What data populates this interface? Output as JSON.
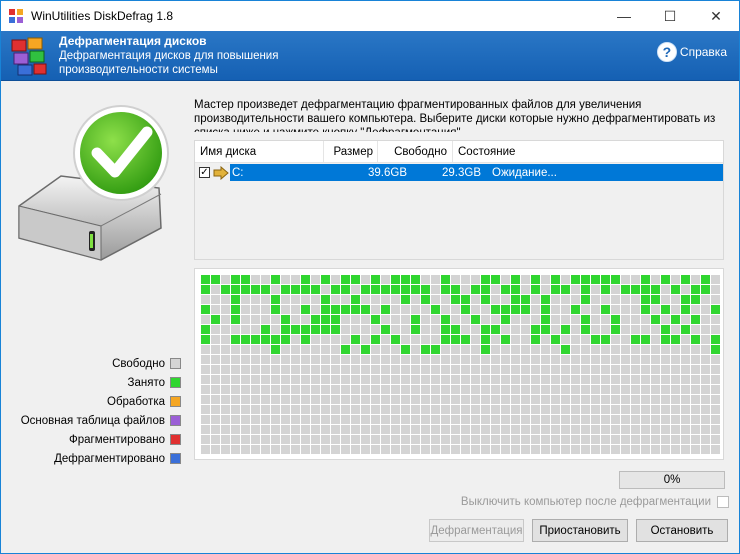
{
  "window": {
    "title": "WinUtilities DiskDefrag 1.8",
    "minimize": "—",
    "maximize": "☐",
    "close": "✕"
  },
  "banner": {
    "title": "Дефрагментация дисков",
    "description": "Дефрагментация дисков для повышения производительности системы",
    "help_label": "Справка",
    "help_icon": "?"
  },
  "intro_text": "Мастер произведет дефрагментацию фрагментированных файлов для увеличения производительности вашего компьютера. Выберите диски которые нужно дефрагментировать из списка ниже и нажмите кнопку \"Дефрагментация\"",
  "disk_list": {
    "columns": [
      "Имя диска",
      "Размер",
      "Свободно",
      "Состояние"
    ],
    "rows": [
      {
        "checked": "✓",
        "name": "C:",
        "size": "39.6GB",
        "free": "29.3GB",
        "state": "Ожидание..."
      }
    ]
  },
  "cluster_map": {
    "cols": 52,
    "rows": 18,
    "colors": {
      "free": "#d4d4d4",
      "used": "#30d630"
    },
    "used_cells": [
      [
        0,
        0
      ],
      [
        1,
        0
      ],
      [
        3,
        0
      ],
      [
        4,
        0
      ],
      [
        7,
        0
      ],
      [
        10,
        0
      ],
      [
        12,
        0
      ],
      [
        14,
        0
      ],
      [
        15,
        0
      ],
      [
        17,
        0
      ],
      [
        19,
        0
      ],
      [
        20,
        0
      ],
      [
        21,
        0
      ],
      [
        24,
        0
      ],
      [
        28,
        0
      ],
      [
        29,
        0
      ],
      [
        31,
        0
      ],
      [
        33,
        0
      ],
      [
        35,
        0
      ],
      [
        37,
        0
      ],
      [
        38,
        0
      ],
      [
        39,
        0
      ],
      [
        40,
        0
      ],
      [
        41,
        0
      ],
      [
        44,
        0
      ],
      [
        46,
        0
      ],
      [
        48,
        0
      ],
      [
        50,
        0
      ],
      [
        0,
        1
      ],
      [
        2,
        1
      ],
      [
        3,
        1
      ],
      [
        4,
        1
      ],
      [
        5,
        1
      ],
      [
        6,
        1
      ],
      [
        8,
        1
      ],
      [
        9,
        1
      ],
      [
        10,
        1
      ],
      [
        11,
        1
      ],
      [
        13,
        1
      ],
      [
        14,
        1
      ],
      [
        16,
        1
      ],
      [
        17,
        1
      ],
      [
        18,
        1
      ],
      [
        19,
        1
      ],
      [
        20,
        1
      ],
      [
        21,
        1
      ],
      [
        22,
        1
      ],
      [
        24,
        1
      ],
      [
        25,
        1
      ],
      [
        27,
        1
      ],
      [
        28,
        1
      ],
      [
        30,
        1
      ],
      [
        31,
        1
      ],
      [
        33,
        1
      ],
      [
        35,
        1
      ],
      [
        36,
        1
      ],
      [
        38,
        1
      ],
      [
        40,
        1
      ],
      [
        42,
        1
      ],
      [
        43,
        1
      ],
      [
        44,
        1
      ],
      [
        45,
        1
      ],
      [
        47,
        1
      ],
      [
        49,
        1
      ],
      [
        50,
        1
      ],
      [
        3,
        2
      ],
      [
        7,
        2
      ],
      [
        12,
        2
      ],
      [
        15,
        2
      ],
      [
        20,
        2
      ],
      [
        22,
        2
      ],
      [
        25,
        2
      ],
      [
        26,
        2
      ],
      [
        28,
        2
      ],
      [
        31,
        2
      ],
      [
        32,
        2
      ],
      [
        34,
        2
      ],
      [
        38,
        2
      ],
      [
        44,
        2
      ],
      [
        45,
        2
      ],
      [
        48,
        2
      ],
      [
        49,
        2
      ],
      [
        0,
        3
      ],
      [
        3,
        3
      ],
      [
        7,
        3
      ],
      [
        10,
        3
      ],
      [
        12,
        3
      ],
      [
        13,
        3
      ],
      [
        14,
        3
      ],
      [
        15,
        3
      ],
      [
        16,
        3
      ],
      [
        18,
        3
      ],
      [
        23,
        3
      ],
      [
        26,
        3
      ],
      [
        29,
        3
      ],
      [
        30,
        3
      ],
      [
        31,
        3
      ],
      [
        32,
        3
      ],
      [
        34,
        3
      ],
      [
        37,
        3
      ],
      [
        40,
        3
      ],
      [
        44,
        3
      ],
      [
        46,
        3
      ],
      [
        48,
        3
      ],
      [
        51,
        3
      ],
      [
        1,
        4
      ],
      [
        3,
        4
      ],
      [
        8,
        4
      ],
      [
        11,
        4
      ],
      [
        12,
        4
      ],
      [
        13,
        4
      ],
      [
        17,
        4
      ],
      [
        21,
        4
      ],
      [
        24,
        4
      ],
      [
        27,
        4
      ],
      [
        30,
        4
      ],
      [
        34,
        4
      ],
      [
        38,
        4
      ],
      [
        41,
        4
      ],
      [
        45,
        4
      ],
      [
        47,
        4
      ],
      [
        49,
        4
      ],
      [
        0,
        5
      ],
      [
        6,
        5
      ],
      [
        8,
        5
      ],
      [
        9,
        5
      ],
      [
        10,
        5
      ],
      [
        11,
        5
      ],
      [
        12,
        5
      ],
      [
        13,
        5
      ],
      [
        18,
        5
      ],
      [
        21,
        5
      ],
      [
        24,
        5
      ],
      [
        25,
        5
      ],
      [
        28,
        5
      ],
      [
        29,
        5
      ],
      [
        33,
        5
      ],
      [
        34,
        5
      ],
      [
        36,
        5
      ],
      [
        38,
        5
      ],
      [
        41,
        5
      ],
      [
        46,
        5
      ],
      [
        48,
        5
      ],
      [
        0,
        6
      ],
      [
        3,
        6
      ],
      [
        4,
        6
      ],
      [
        5,
        6
      ],
      [
        6,
        6
      ],
      [
        7,
        6
      ],
      [
        8,
        6
      ],
      [
        10,
        6
      ],
      [
        15,
        6
      ],
      [
        17,
        6
      ],
      [
        19,
        6
      ],
      [
        24,
        6
      ],
      [
        25,
        6
      ],
      [
        26,
        6
      ],
      [
        28,
        6
      ],
      [
        30,
        6
      ],
      [
        33,
        6
      ],
      [
        35,
        6
      ],
      [
        39,
        6
      ],
      [
        40,
        6
      ],
      [
        43,
        6
      ],
      [
        44,
        6
      ],
      [
        46,
        6
      ],
      [
        47,
        6
      ],
      [
        49,
        6
      ],
      [
        51,
        6
      ],
      [
        7,
        7
      ],
      [
        14,
        7
      ],
      [
        16,
        7
      ],
      [
        20,
        7
      ],
      [
        22,
        7
      ],
      [
        23,
        7
      ],
      [
        28,
        7
      ],
      [
        36,
        7
      ],
      [
        51,
        7
      ]
    ]
  },
  "legend": [
    {
      "label": "Свободно",
      "color": "#d4d4d4"
    },
    {
      "label": "Занято",
      "color": "#30d630"
    },
    {
      "label": "Обработка",
      "color": "#f5a623"
    },
    {
      "label": "Основная таблица файлов",
      "color": "#9b5fd6"
    },
    {
      "label": "Фрагментировано",
      "color": "#e03030"
    },
    {
      "label": "Дефрагментировано",
      "color": "#3a6fd8"
    }
  ],
  "progress": {
    "percent": 0,
    "label": "0%"
  },
  "shutdown_label": "Выключить компьютер после дефрагментации",
  "buttons": {
    "defrag": "Дефрагментация",
    "pause": "Приостановить",
    "stop": "Остановить"
  }
}
